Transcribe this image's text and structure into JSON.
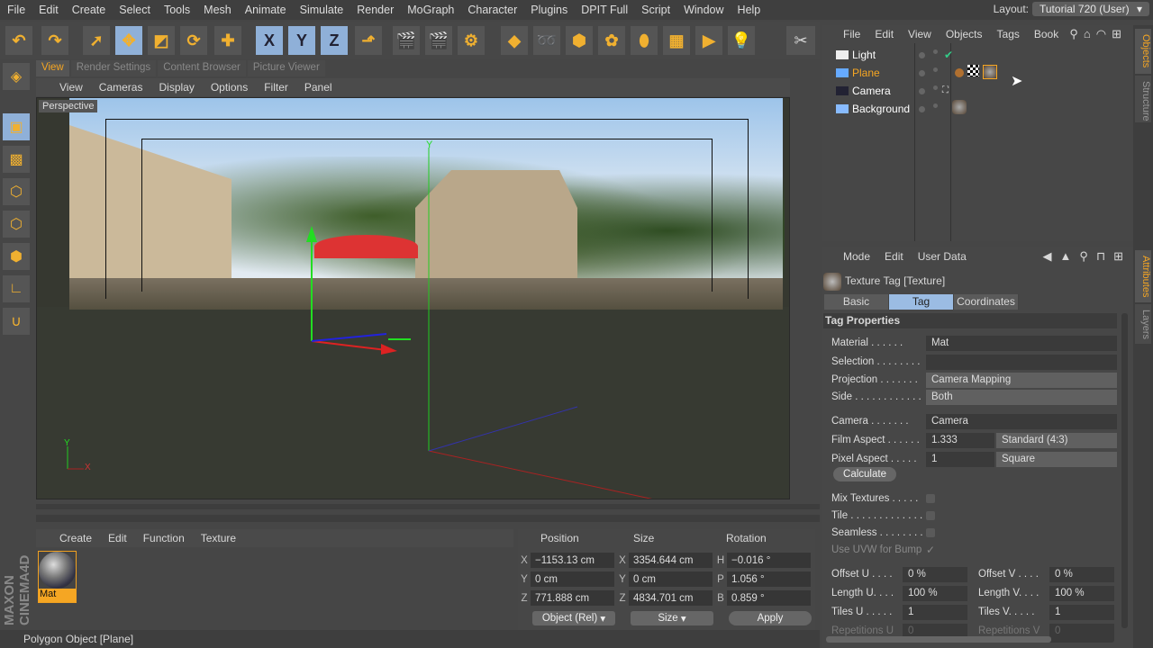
{
  "menu": [
    "File",
    "Edit",
    "Create",
    "Select",
    "Tools",
    "Mesh",
    "Animate",
    "Simulate",
    "Render",
    "MoGraph",
    "Character",
    "Plugins",
    "DPIT Full",
    "Script",
    "Window",
    "Help"
  ],
  "layout": {
    "label": "Layout:",
    "value": "Tutorial 720 (User)"
  },
  "toolbar": [
    {
      "name": "undo-icon",
      "g": "↶"
    },
    {
      "name": "redo-icon",
      "g": "↷"
    },
    {
      "name": "live-selection-icon",
      "g": "➚"
    },
    {
      "name": "move-icon",
      "g": "✥"
    },
    {
      "name": "scale-icon",
      "g": "◩"
    },
    {
      "name": "rotate-icon",
      "g": "⟳"
    },
    {
      "name": "last-tool-icon",
      "g": "✚"
    },
    {
      "name": "x-axis-lock-icon",
      "g": "X"
    },
    {
      "name": "y-axis-lock-icon",
      "g": "Y"
    },
    {
      "name": "z-axis-lock-icon",
      "g": "Z"
    },
    {
      "name": "coordinate-system-icon",
      "g": "⬏"
    },
    {
      "name": "render-view-icon",
      "g": "🎬"
    },
    {
      "name": "render-picture-viewer-icon",
      "g": "🎬"
    },
    {
      "name": "render-settings-icon",
      "g": "⚙"
    },
    {
      "name": "cube-icon",
      "g": "◆"
    },
    {
      "name": "spline-icon",
      "g": "➿"
    },
    {
      "name": "nurbs-icon",
      "g": "⬢"
    },
    {
      "name": "mograph-cloner-icon",
      "g": "✿"
    },
    {
      "name": "deformer-icon",
      "g": "⬮"
    },
    {
      "name": "floor-icon",
      "g": "▦"
    },
    {
      "name": "camera-icon",
      "g": "▶"
    },
    {
      "name": "light-icon",
      "g": "💡"
    }
  ],
  "left_tools": [
    {
      "name": "make-editable-icon",
      "g": "◈"
    },
    {
      "name": "model-mode-icon",
      "g": "▣"
    },
    {
      "name": "texture-mode-icon",
      "g": "▩"
    },
    {
      "name": "points-mode-icon",
      "g": "⬡"
    },
    {
      "name": "edges-mode-icon",
      "g": "⬡"
    },
    {
      "name": "polygons-mode-icon",
      "g": "⬢"
    },
    {
      "name": "workplane-icon",
      "g": "∟"
    },
    {
      "name": "magnet-icon",
      "g": "∪"
    }
  ],
  "tabs": [
    "View",
    "Render Settings",
    "Content Browser",
    "Picture Viewer"
  ],
  "viewport_menu": [
    "View",
    "Cameras",
    "Display",
    "Options",
    "Filter",
    "Panel"
  ],
  "viewport": {
    "label": "Perspective",
    "axis_y": "Y",
    "axis_x": "X"
  },
  "material_manager": {
    "menu": [
      "Create",
      "Edit",
      "Function",
      "Texture"
    ],
    "materials": [
      "Mat"
    ]
  },
  "brand": "MAXON CINEMA 4D",
  "coordinates": {
    "headers": [
      "Position",
      "Size",
      "Rotation"
    ],
    "rows": [
      {
        "a1": "X",
        "pos": "−1153.13 cm",
        "a2": "X",
        "size": "3354.644 cm",
        "a3": "H",
        "rot": "−0.016 °"
      },
      {
        "a1": "Y",
        "pos": "0 cm",
        "a2": "Y",
        "size": "0 cm",
        "a3": "P",
        "rot": "1.056 °"
      },
      {
        "a1": "Z",
        "pos": "771.888 cm",
        "a2": "Z",
        "size": "4834.701 cm",
        "a3": "B",
        "rot": "0.859 °"
      }
    ],
    "mode": "Object (Rel)",
    "size_mode": "Size",
    "apply": "Apply"
  },
  "status": "Polygon Object [Plane]",
  "object_manager": {
    "menu": [
      "File",
      "Edit",
      "View",
      "Objects",
      "Tags",
      "Book"
    ],
    "objects": [
      {
        "name": "Light",
        "color": "#ffffff"
      },
      {
        "name": "Plane",
        "color": "#f5a623"
      },
      {
        "name": "Camera",
        "color": "#ffffff"
      },
      {
        "name": "Background",
        "color": "#ffffff"
      }
    ]
  },
  "side_tabs": [
    "Objects",
    "Structure",
    "Attributes",
    "Layers"
  ],
  "attributes": {
    "menu": [
      "Mode",
      "Edit",
      "User Data"
    ],
    "title": "Texture Tag [Texture]",
    "tabs": [
      "Basic",
      "Tag",
      "Coordinates"
    ],
    "section": "Tag Properties",
    "material": {
      "label": "Material . . . . . .",
      "value": "Mat"
    },
    "selection": {
      "label": "Selection . . . . . . . .",
      "value": ""
    },
    "projection": {
      "label": "Projection . . . . . . .",
      "value": "Camera Mapping"
    },
    "side": {
      "label": "Side . . . . . . . . . . . .",
      "value": "Both"
    },
    "camera": {
      "label": "Camera . . . . . . .",
      "value": "Camera"
    },
    "film_aspect": {
      "label": "Film Aspect . . . . . .",
      "value": "1.333",
      "preset": "Standard (4:3)"
    },
    "pixel_aspect": {
      "label": "Pixel Aspect . . . . .",
      "value": "1",
      "preset": "Square"
    },
    "calculate": "Calculate",
    "mix_textures": "Mix Textures . . . . .",
    "tile": "Tile . . . . . . . . . . . . .",
    "seamless": "Seamless . . . . . . . .",
    "use_uvw": "Use UVW for Bump",
    "offset_u": {
      "label": "Offset U . . . .",
      "value": "0 %"
    },
    "offset_v": {
      "label": "Offset V . . . .",
      "value": "0 %"
    },
    "length_u": {
      "label": "Length U. . . .",
      "value": "100 %"
    },
    "length_v": {
      "label": "Length V. . . .",
      "value": "100 %"
    },
    "tiles_u": {
      "label": "Tiles U . . . . .",
      "value": "1"
    },
    "tiles_v": {
      "label": "Tiles V. . . . .",
      "value": "1"
    },
    "rep_u": {
      "label": "Repetitions U",
      "value": "0"
    },
    "rep_v": {
      "label": "Repetitions V",
      "value": "0"
    }
  }
}
